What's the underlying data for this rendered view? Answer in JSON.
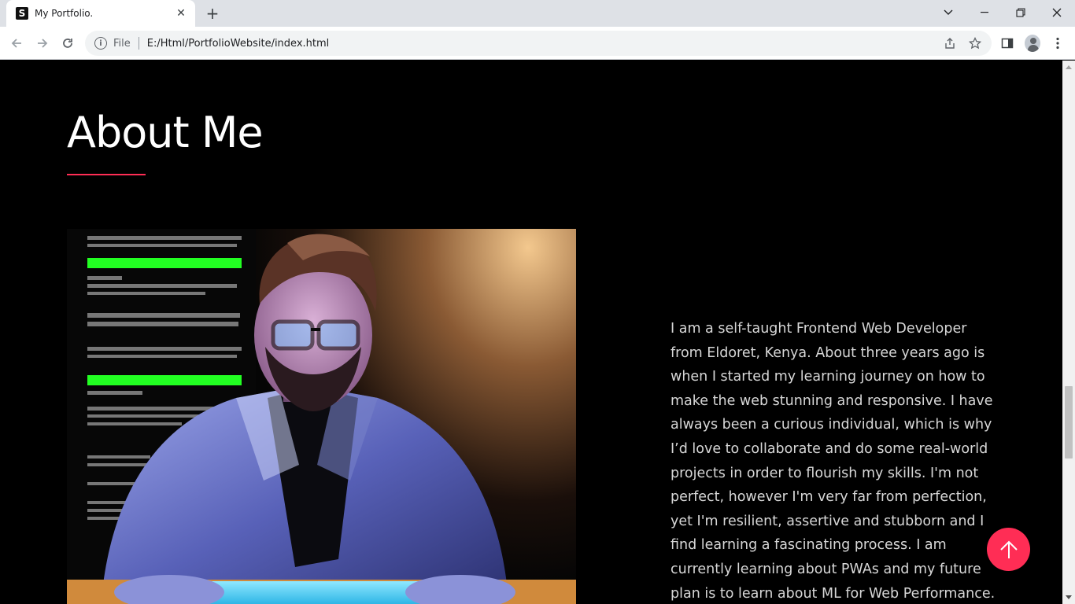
{
  "browser": {
    "tab_title": "My Portfolio.",
    "favicon_letter": "S",
    "scheme_label": "File",
    "url": "E:/Html/PortfolioWebsite/index.html"
  },
  "about": {
    "title": "About Me",
    "paragraph": "I am a self-taught Frontend Web Developer from Eldoret, Kenya. About three years ago is when I started my learning journey on how to make the web stunning and responsive. I have always been a curious individual, which is why I’d love to collaborate and do some real-world projects in order to flourish my skills. I'm not perfect, however I'm very far from perfection, yet I'm resilient, assertive and stubborn and I find learning a fascinating process. I am currently learning about PWAs and my future plan is to learn about ML for Web Performance.",
    "accent_color": "#ff2d55"
  },
  "icons": {
    "back": "arrow-left-icon",
    "forward": "arrow-right-icon",
    "reload": "reload-icon",
    "info": "info-icon",
    "share": "share-icon",
    "bookmark": "star-icon",
    "sidepanel": "side-panel-icon",
    "profile": "profile-icon",
    "menu": "kebab-menu-icon",
    "to_top": "arrow-up-icon"
  }
}
